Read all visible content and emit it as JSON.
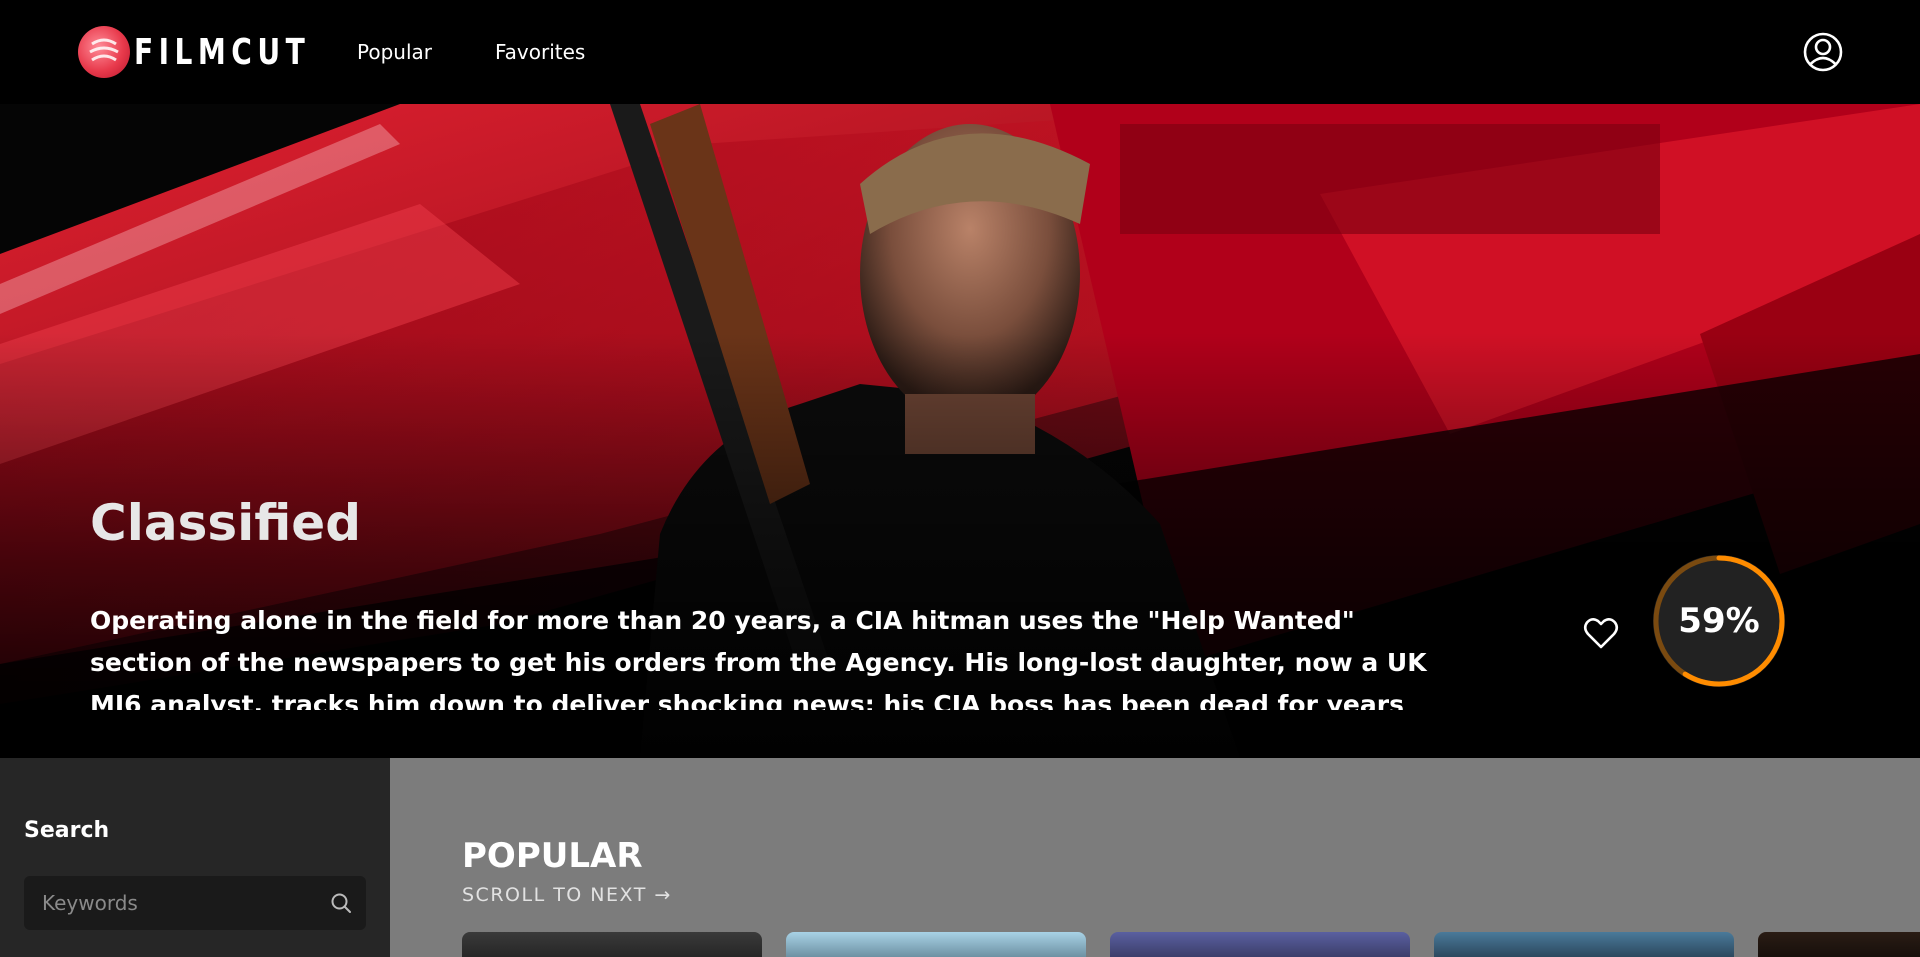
{
  "app": {
    "logo_text": "FILMCUT",
    "nav": [
      {
        "label": "Popular"
      },
      {
        "label": "Favorites"
      }
    ]
  },
  "hero": {
    "title": "Classified",
    "description": "Operating alone in the field for more than 20 years, a CIA hitman uses the \"Help Wanted\" section of the newspapers to get his orders from the Agency. His long-lost daughter, now a UK MI6 analyst, tracks him down to deliver shocking news: his CIA boss has been dead for years and the division long since shut",
    "rating_value": 59,
    "rating_label": "59%",
    "rating_color": "#ff8c00",
    "accent": "#c8102e"
  },
  "sidebar": {
    "search_label": "Search",
    "search_placeholder": "Keywords"
  },
  "main": {
    "section_title": "POPULAR",
    "scroll_next": "SCROLL TO NEXT →"
  }
}
